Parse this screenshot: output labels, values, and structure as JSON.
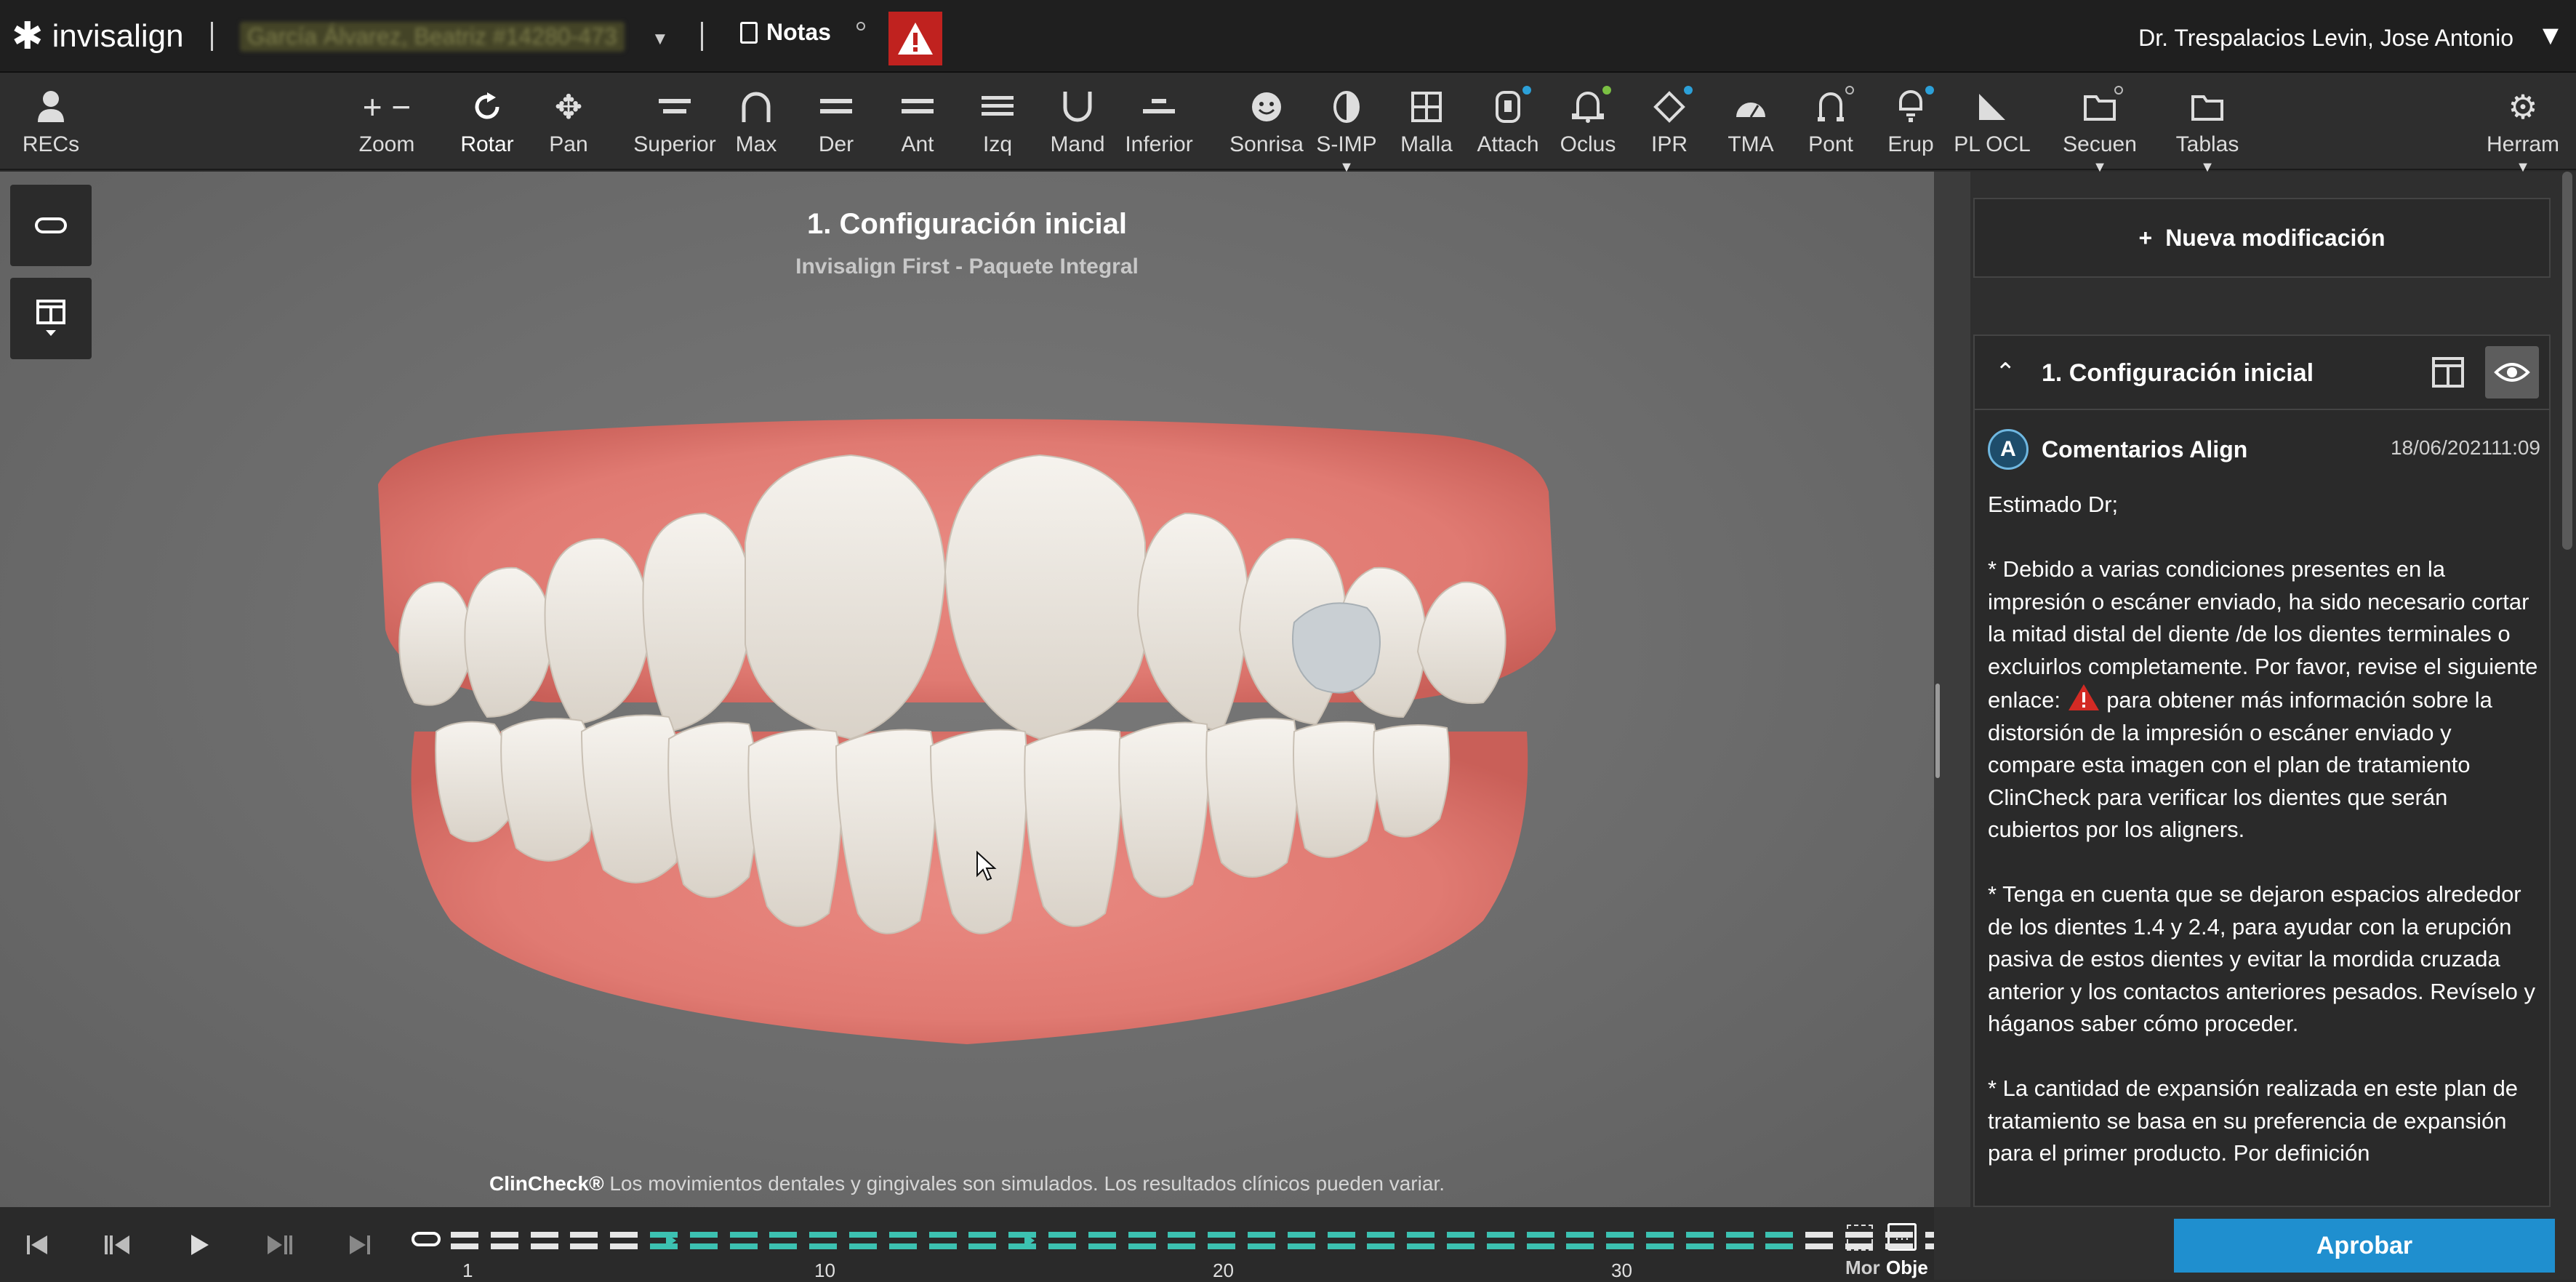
{
  "header": {
    "brand": "invisalign",
    "patient": "García Álvarez, Beatriz #14280-473",
    "notes_label": "Notas",
    "doctor": "Dr. Trespalacios Levin, Jose Antonio"
  },
  "toolbar": {
    "recs": "RECs",
    "zoom": "Zoom",
    "rotar": "Rotar",
    "pan": "Pan",
    "superior": "Superior",
    "max": "Max",
    "der": "Der",
    "ant": "Ant",
    "izq": "Izq",
    "mand": "Mand",
    "inferior": "Inferior",
    "sonrisa": "Sonrisa",
    "simp": "S-IMP",
    "malla": "Malla",
    "attach": "Attach",
    "oclus": "Oclus",
    "ipr": "IPR",
    "tma": "TMA",
    "pont": "Pont",
    "erup": "Erup",
    "ploc": "PL OCL",
    "secuen": "Secuen",
    "tablas": "Tablas",
    "herram": "Herram",
    "accent_color": "#2ca0d8"
  },
  "viewport": {
    "title": "1. Configuración inicial",
    "subtitle": "Invisalign First - Paquete Integral",
    "disclaimer_brand": "ClinCheck®",
    "disclaimer_text": " Los movimientos dentales y gingivales son simulados. Los resultados clínicos pueden variar."
  },
  "panel": {
    "new_modification": "Nueva modificación",
    "card_title": "1. Configuración inicial",
    "comment_avatar": "A",
    "comment_author": "Comentarios Align",
    "comment_date": "18/06/202111:09",
    "greeting": "Estimado Dr;",
    "para1_a": "* Debido a varias condiciones presentes en la impresión o escáner enviado, ha sido necesario cortar la mitad distal del diente /de los dientes terminales o excluirlos completamente. Por favor, revise el siguiente enlace: ",
    "para1_b": " para obtener más información sobre la distorsión de la impresión o escáner enviado y compare esta imagen con el plan de tratamiento ClinCheck para verificar los dientes que serán cubiertos por los aligners.",
    "para2": "* Tenga en cuenta que se dejaron espacios alrededor de los dientes 1.4 y 2.4, para ayudar con la erupción pasiva de estos dientes y evitar la mordida cruzada anterior y los contactos anteriores pesados. Revíselo y háganos saber cómo proceder.",
    "para3": "* La cantidad de expansión realizada en este plan de tratamiento se basa en su preferencia de expansión para el primer producto. Por definición"
  },
  "timeline": {
    "stages_white_start": 5,
    "stages_teal": 29,
    "stages_white_end": 4,
    "labels": [
      "1",
      "10",
      "20",
      "30"
    ],
    "mor": "Mor",
    "obje": "Obje",
    "teal_color": "#3cc1b1"
  },
  "footer": {
    "approve": "Aprobar"
  }
}
